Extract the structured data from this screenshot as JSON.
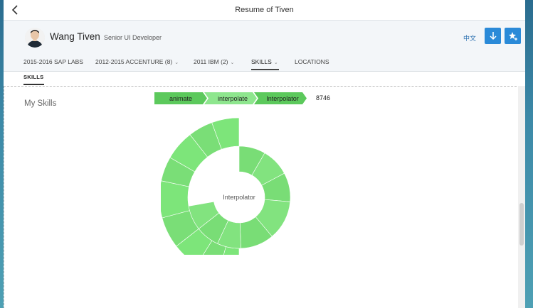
{
  "window": {
    "title": "Resume of Tiven"
  },
  "profile": {
    "name": "Wang Tiven",
    "role": "Senior UI Developer"
  },
  "header": {
    "language_label": "中文"
  },
  "tabs": [
    {
      "label": "2015-2016 SAP LABS",
      "has_dropdown": false
    },
    {
      "label": "2012-2015 ACCENTURE (8)",
      "has_dropdown": true
    },
    {
      "label": "2011 IBM (2)",
      "has_dropdown": true
    },
    {
      "label": "SKILLS",
      "has_dropdown": true,
      "active": true
    },
    {
      "label": "LOCATIONS",
      "has_dropdown": false
    }
  ],
  "subtab": {
    "label": "SKILLS"
  },
  "section": {
    "title": "My Skills"
  },
  "breadcrumb": {
    "items": [
      "animate",
      "interpolate",
      "Interpolator"
    ],
    "value": "8746"
  },
  "sunburst": {
    "center_label": "Interpolator"
  },
  "colors": {
    "accent": "#2a8ad8",
    "crumb_active": "#5cc95c",
    "crumb_inactive": "#8ee68e",
    "arc_outer": "#7de57a",
    "arc_inner": "#90ee90"
  },
  "icons": {
    "back": "chevron-left-icon",
    "download": "arrow-down-icon",
    "favorite": "star-plus-icon"
  }
}
